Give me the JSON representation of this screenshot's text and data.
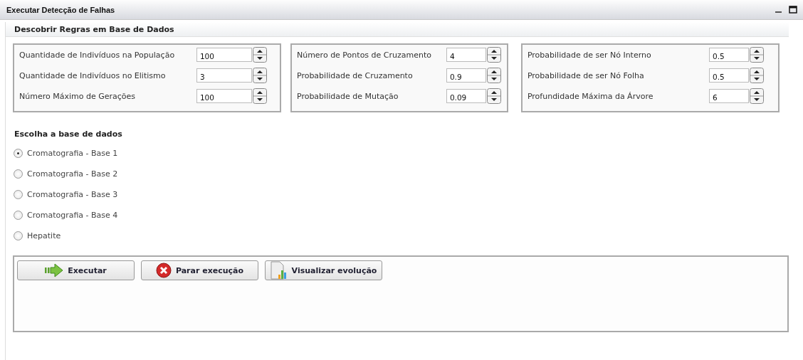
{
  "window": {
    "title": "Executar Detecção de Falhas"
  },
  "section_title": "Descobrir Regras em Base de Dados",
  "parameter_groups": [
    {
      "fields": [
        {
          "label": "Quantidade de Indivíduos na População",
          "value": "100"
        },
        {
          "label": "Quantidade de Indivíduos no Elitismo",
          "value": "3"
        },
        {
          "label": "Número Máximo de Gerações",
          "value": "100"
        }
      ]
    },
    {
      "fields": [
        {
          "label": "Número de Pontos de Cruzamento",
          "value": "4"
        },
        {
          "label": "Probabilidade de Cruzamento",
          "value": "0.9"
        },
        {
          "label": "Probabilidade de Mutação",
          "value": "0.09"
        }
      ]
    },
    {
      "fields": [
        {
          "label": "Probabilidade de ser Nó Interno",
          "value": "0.5"
        },
        {
          "label": "Probabilidade de ser Nó Folha",
          "value": "0.5"
        },
        {
          "label": "Profundidade Máxima da Árvore",
          "value": "6"
        }
      ]
    }
  ],
  "database_choice": {
    "title": "Escolha a base de dados",
    "options": [
      {
        "label": "Cromatografia - Base 1",
        "selected": true
      },
      {
        "label": "Cromatografia - Base 2",
        "selected": false
      },
      {
        "label": "Cromatografia - Base 3",
        "selected": false
      },
      {
        "label": "Cromatografia - Base 4",
        "selected": false
      },
      {
        "label": "Hepatite",
        "selected": false
      }
    ]
  },
  "buttons": [
    {
      "kind": "run",
      "label": "Executar"
    },
    {
      "kind": "stop",
      "label": "Parar execução"
    },
    {
      "kind": "chart",
      "label": "Visualizar evolução"
    }
  ]
}
